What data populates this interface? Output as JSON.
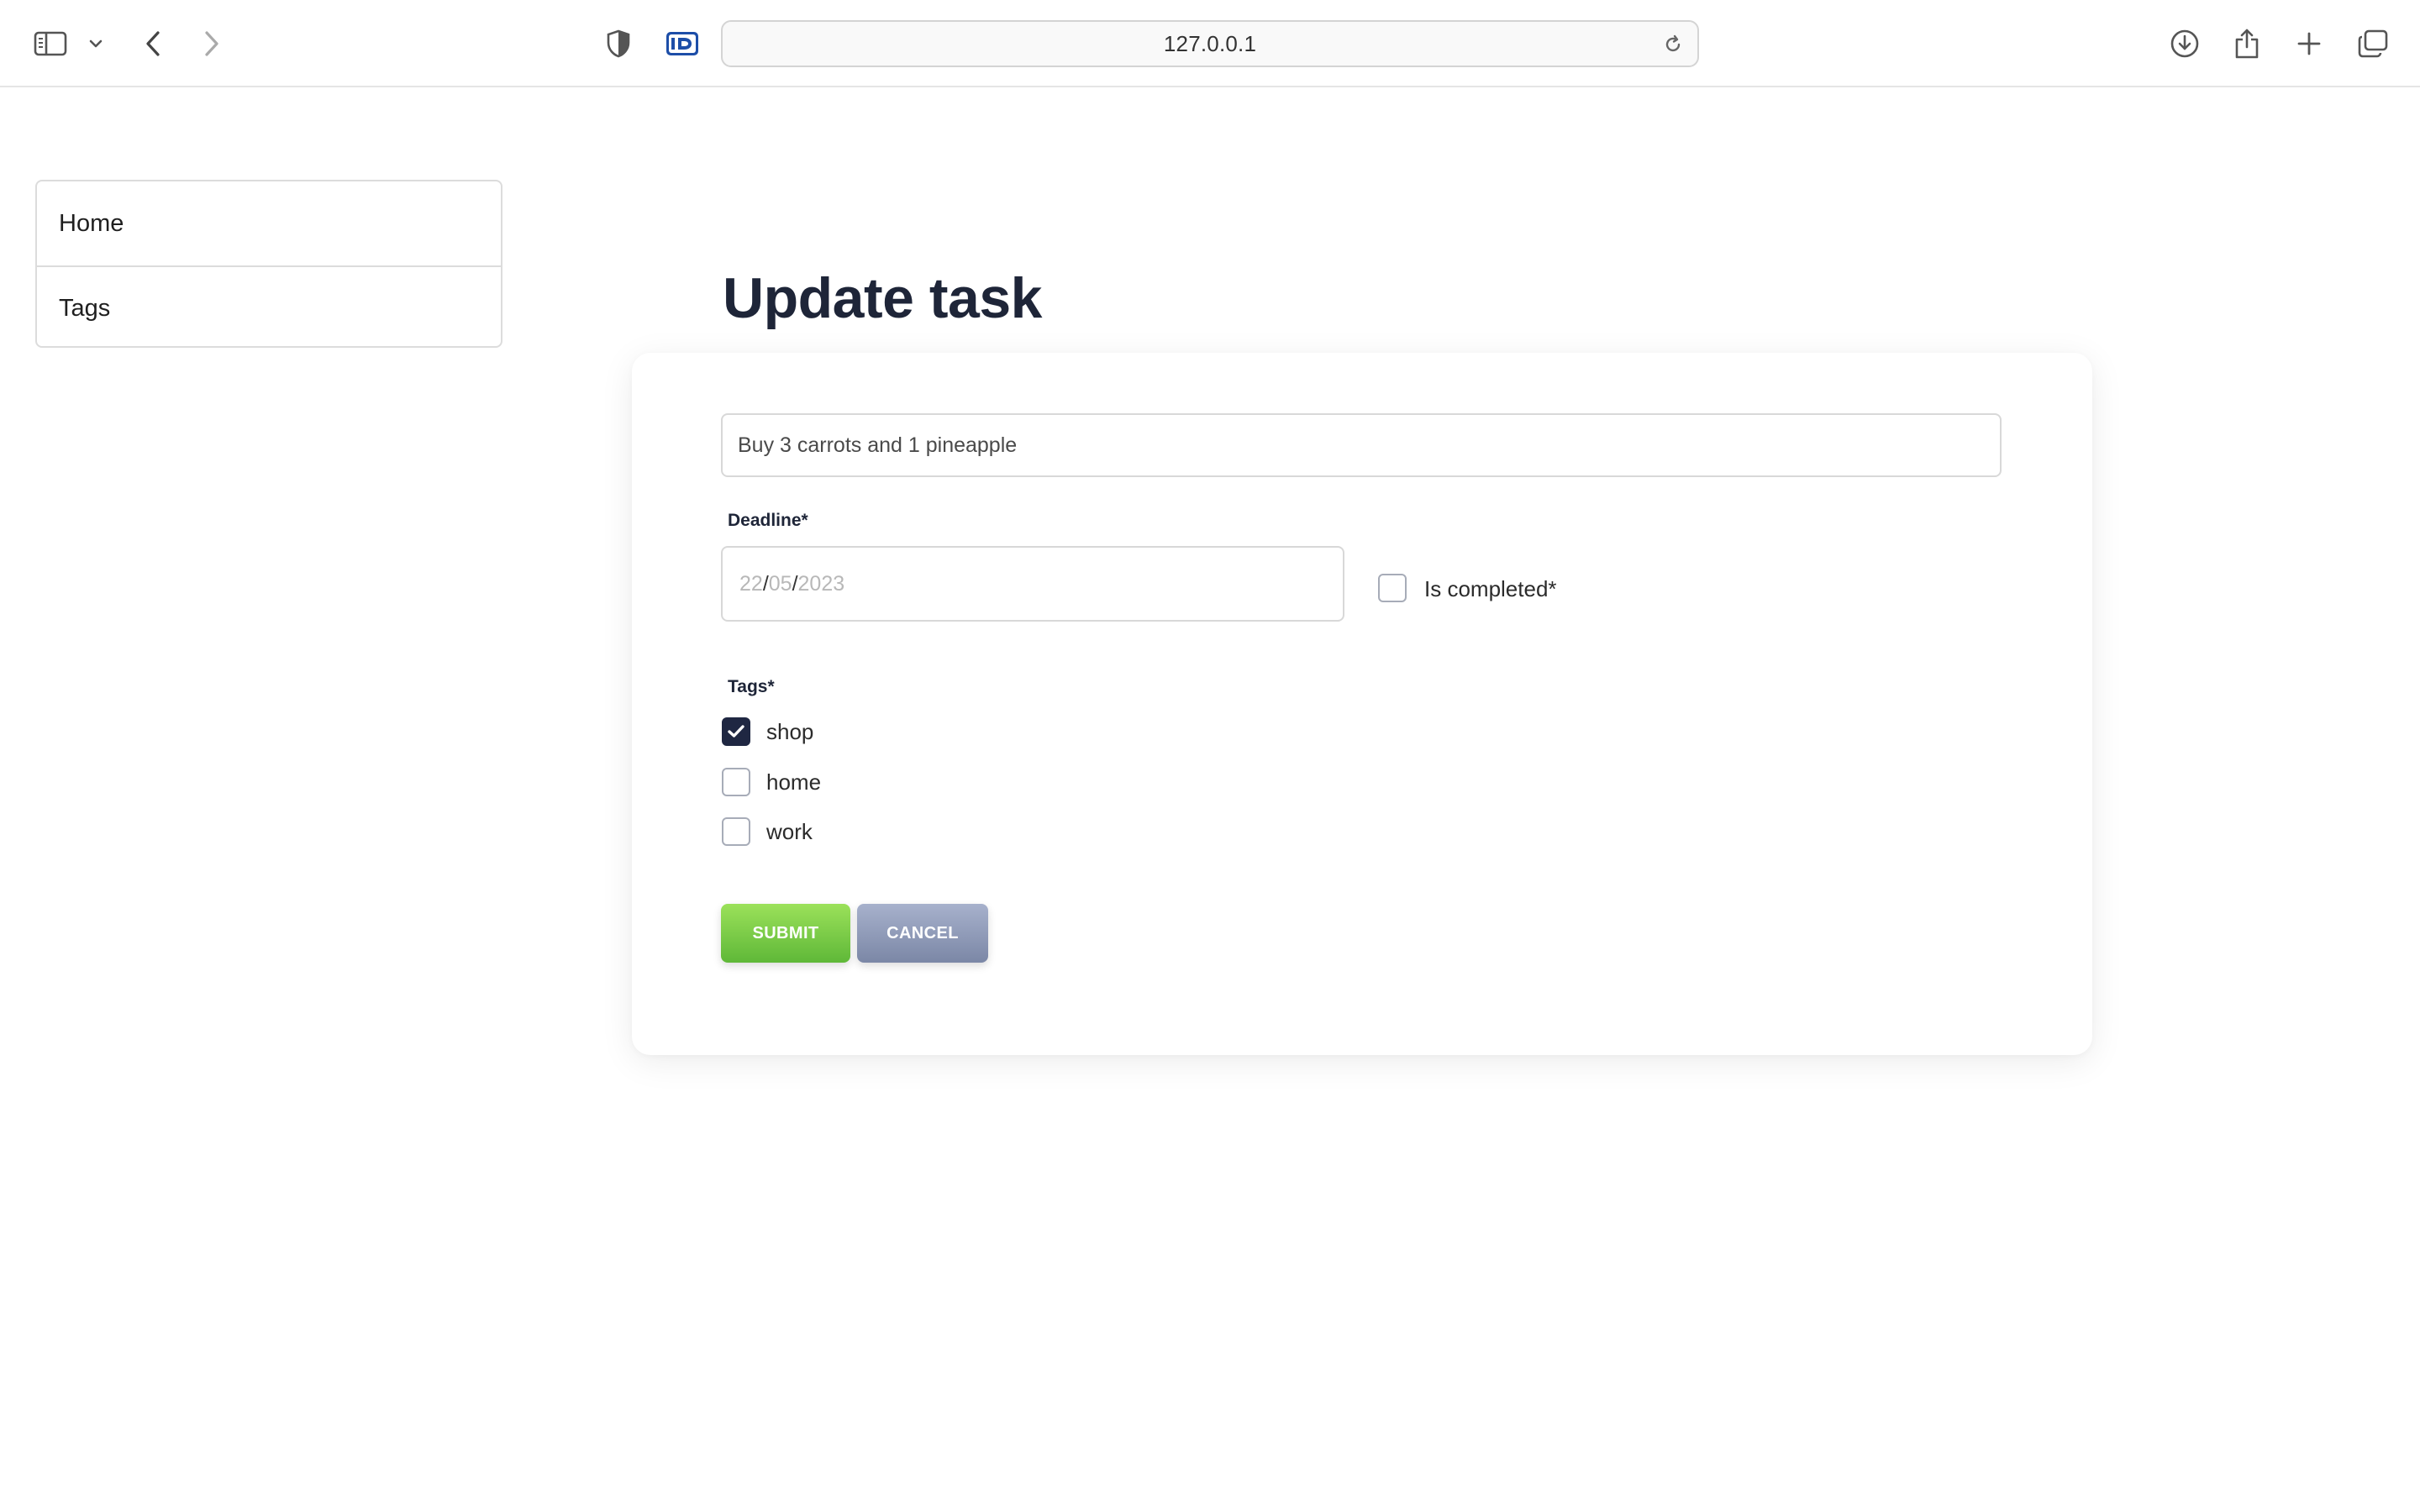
{
  "browser": {
    "url": "127.0.0.1",
    "icons": {
      "sidebar_toggle": "sidebar-icon",
      "chevron": "chevron-down-icon",
      "back": "back-arrow-icon",
      "forward": "forward-arrow-icon",
      "privacy": "shield-icon",
      "extension": "id-extension-icon",
      "reload": "reload-icon",
      "download": "download-icon",
      "share": "share-icon",
      "new_tab": "plus-icon",
      "tabs": "tabs-overview-icon"
    }
  },
  "sidebar": {
    "items": [
      {
        "label": "Home"
      },
      {
        "label": "Tags"
      }
    ]
  },
  "main": {
    "title": "Update task",
    "form": {
      "task_value": "Buy 3 carrots and 1 pineapple",
      "deadline_label": "Deadline*",
      "deadline": {
        "day": "22",
        "month": "05",
        "year": "2023",
        "sep": "/"
      },
      "completed_label": "Is completed*",
      "completed_checked": false,
      "tags_label": "Tags*",
      "tags": [
        {
          "label": "shop",
          "checked": true
        },
        {
          "label": "home",
          "checked": false
        },
        {
          "label": "work",
          "checked": false
        }
      ],
      "submit_label": "SUBMIT",
      "cancel_label": "CANCEL"
    }
  },
  "colors": {
    "title": "#1e2538",
    "submit_gradient": [
      "#9be15a",
      "#5fb838"
    ],
    "cancel_gradient": [
      "#a7b1cc",
      "#7b87a6"
    ],
    "checkbox_checked": "#1f2742"
  }
}
